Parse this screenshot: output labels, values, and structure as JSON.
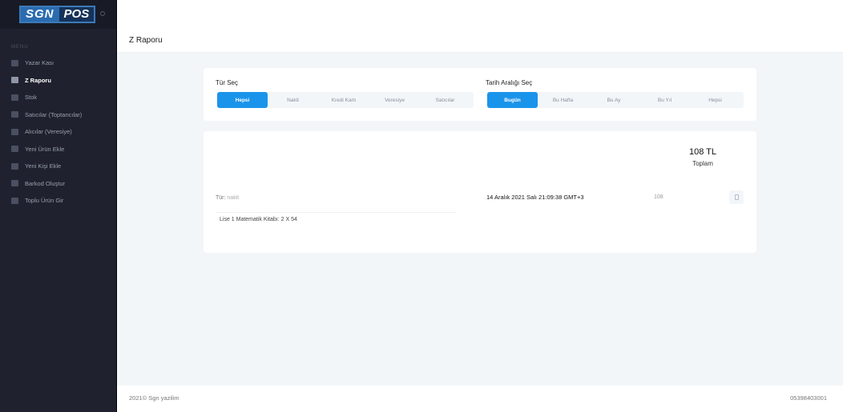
{
  "sidebar": {
    "logo": {
      "part1": "SGN",
      "part2": "POS"
    },
    "menu_title": "MENU",
    "items": [
      {
        "label": "Yazar Kası",
        "icon": "cash-register-icon",
        "active": false
      },
      {
        "label": "Z Raporu",
        "icon": "user-report-icon",
        "active": true
      },
      {
        "label": "Stok",
        "icon": "box-icon",
        "active": false
      },
      {
        "label": "Satıcılar (Toptancılar)",
        "icon": "truck-icon",
        "active": false
      },
      {
        "label": "Alıcılar (Veresiye)",
        "icon": "chart-icon",
        "active": false
      },
      {
        "label": "Yeni Ürün Ekle",
        "icon": "tag-icon",
        "active": false
      },
      {
        "label": "Yeni Kişi Ekle",
        "icon": "add-person-icon",
        "active": false
      },
      {
        "label": "Barkod Oluştur",
        "icon": "barcode-icon",
        "active": false
      },
      {
        "label": "Toplu Ürün Gir",
        "icon": "grid-icon",
        "active": false
      }
    ]
  },
  "header": {
    "title": "Z Raporu"
  },
  "filters": {
    "type_label": "Tür Seç",
    "type_options": [
      "Hepsi",
      "Nakit",
      "Kredi Kartı",
      "Veresiye",
      "Satıcılar"
    ],
    "type_selected": "Hepsi",
    "date_label": "Tarih Aralığı Seç",
    "date_options": [
      "Bugün",
      "Bu Hafta",
      "Bu Ay",
      "Bu Yıl",
      "Hepsi"
    ],
    "date_selected": "Bugün"
  },
  "report": {
    "total_amount": "108 TL",
    "total_label": "Toplam",
    "row": {
      "type_prefix": "Tür:",
      "type_value": "nakit",
      "date": "14 Aralık 2021 Salı 21:09:38 GMT+3",
      "amount": "108",
      "item": "Lise 1 Matematik Kitabı: 2 X 54"
    }
  },
  "footer": {
    "left": "2021© Sgn yazilim",
    "right": "05398403001"
  },
  "colors": {
    "accent": "#1a94ea",
    "sidebar_bg": "#1f222e",
    "logo_blue": "#2b6cb0"
  }
}
